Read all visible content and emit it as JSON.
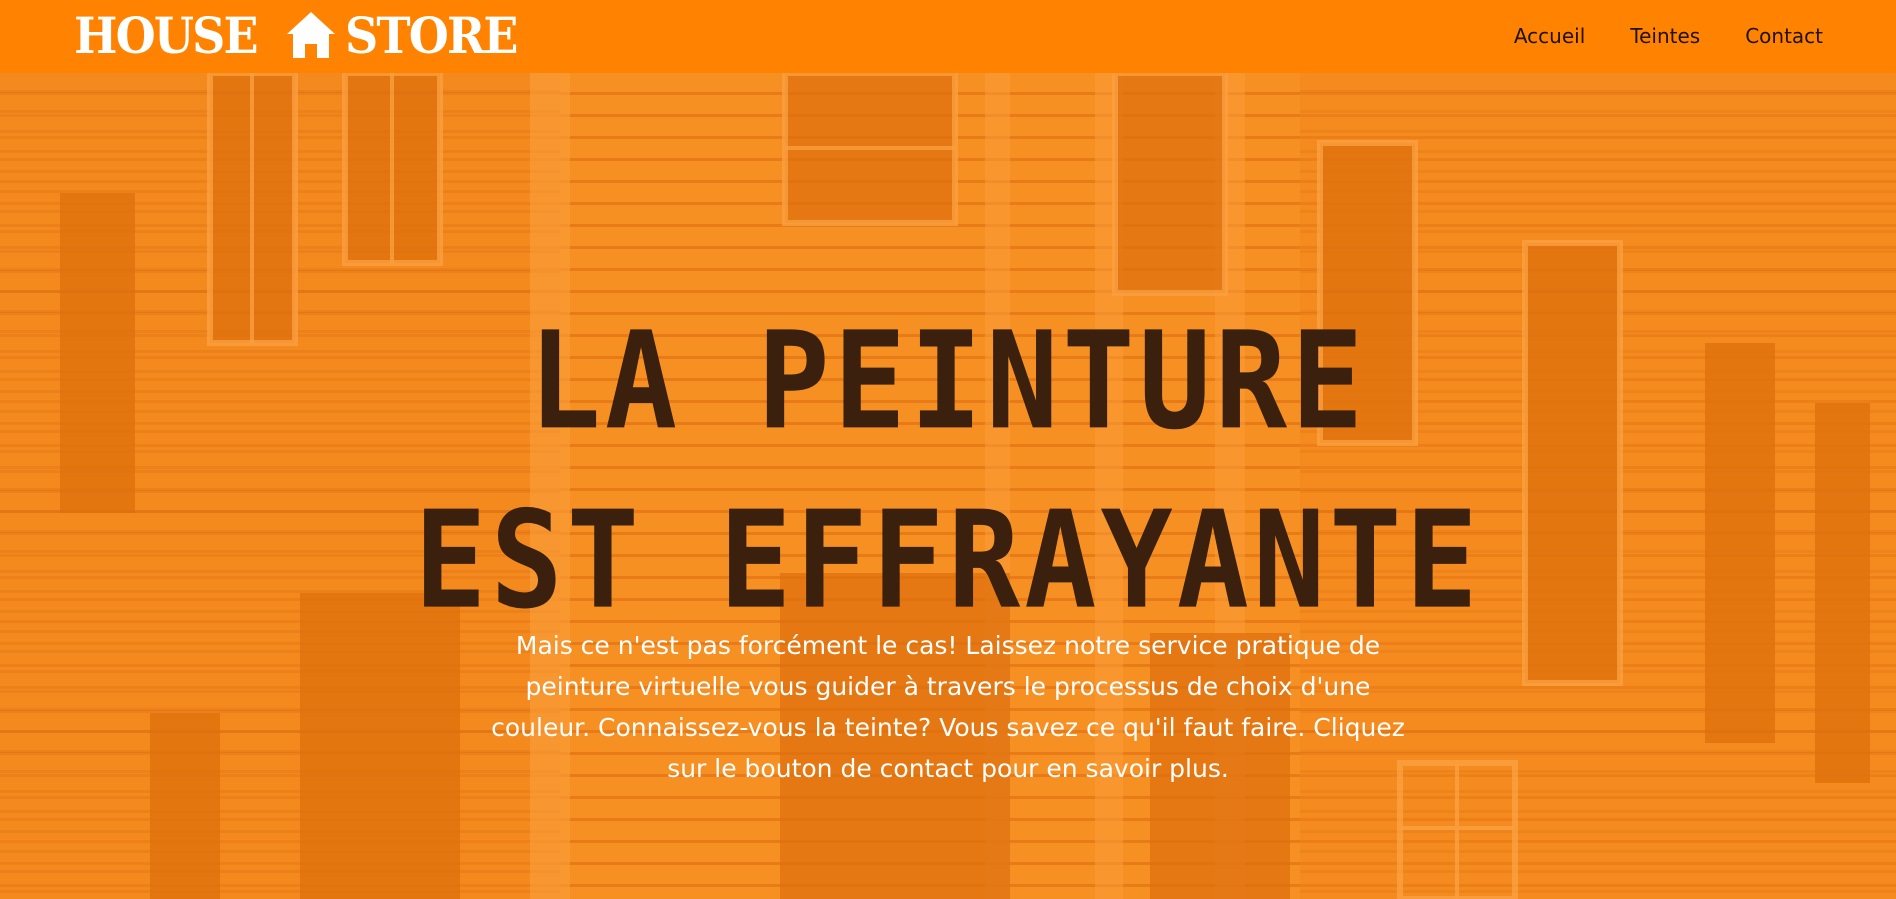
{
  "brand": {
    "logo_left": "HOUSE",
    "logo_right": "STORE",
    "icon": "house-icon"
  },
  "nav": {
    "items": [
      {
        "label": "Accueil"
      },
      {
        "label": "Teintes"
      },
      {
        "label": "Contact"
      }
    ]
  },
  "hero": {
    "title_line_1": "LA PEINTURE",
    "title_line_2": "EST EFFRAYANTE",
    "paragraph": "Mais ce n'est pas forcément le cas! Laissez notre service pratique de peinture virtuelle vous guider à travers le processus de choix d'une couleur. Connaissez-vous la teinte? Vous savez ce qu'il faut faire. Cliquez sur le bouton de contact pour en savoir plus.",
    "background_image": "abandoned-wooden-house-photo"
  },
  "colors": {
    "accent": "#ff8200",
    "title_text": "#3a200d",
    "nav_text": "#1f1208",
    "hero_text": "#ffffff"
  }
}
